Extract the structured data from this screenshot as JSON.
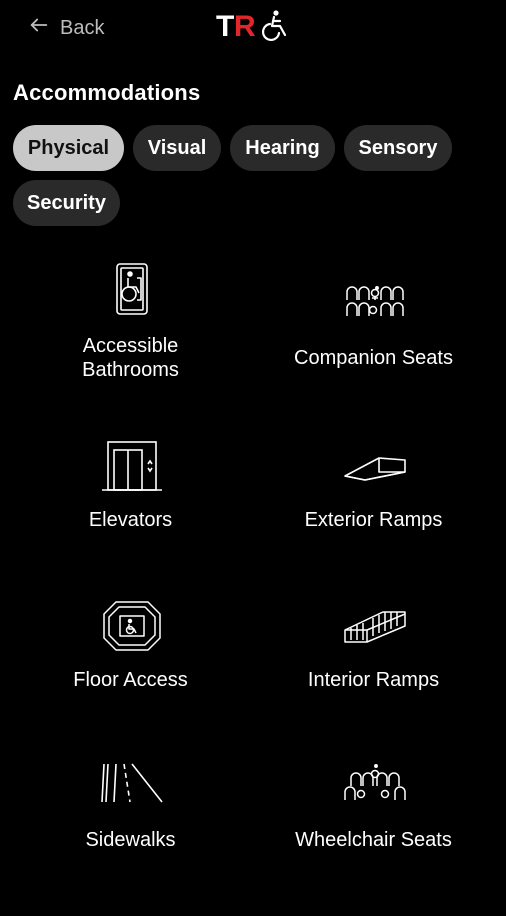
{
  "header": {
    "back_label": "Back",
    "logo_text": "TR"
  },
  "section": {
    "title": "Accommodations"
  },
  "tabs": [
    {
      "label": "Physical",
      "active": true
    },
    {
      "label": "Visual",
      "active": false
    },
    {
      "label": "Hearing",
      "active": false
    },
    {
      "label": "Sensory",
      "active": false
    },
    {
      "label": "Security",
      "active": false
    }
  ],
  "items": [
    {
      "label": "Accessible\nBathrooms",
      "icon": "accessible-bathroom-icon"
    },
    {
      "label": "Companion Seats",
      "icon": "companion-seats-icon"
    },
    {
      "label": "Elevators",
      "icon": "elevator-icon"
    },
    {
      "label": "Exterior Ramps",
      "icon": "exterior-ramp-icon"
    },
    {
      "label": "Floor Access",
      "icon": "floor-access-icon"
    },
    {
      "label": "Interior Ramps",
      "icon": "interior-ramp-icon"
    },
    {
      "label": "Sidewalks",
      "icon": "sidewalk-icon"
    },
    {
      "label": "Wheelchair Seats",
      "icon": "wheelchair-seats-icon"
    }
  ],
  "colors": {
    "background": "#000000",
    "chip": "#2a2a2a",
    "chip_active": "#c8c8c8",
    "brand_red": "#e3262b"
  }
}
